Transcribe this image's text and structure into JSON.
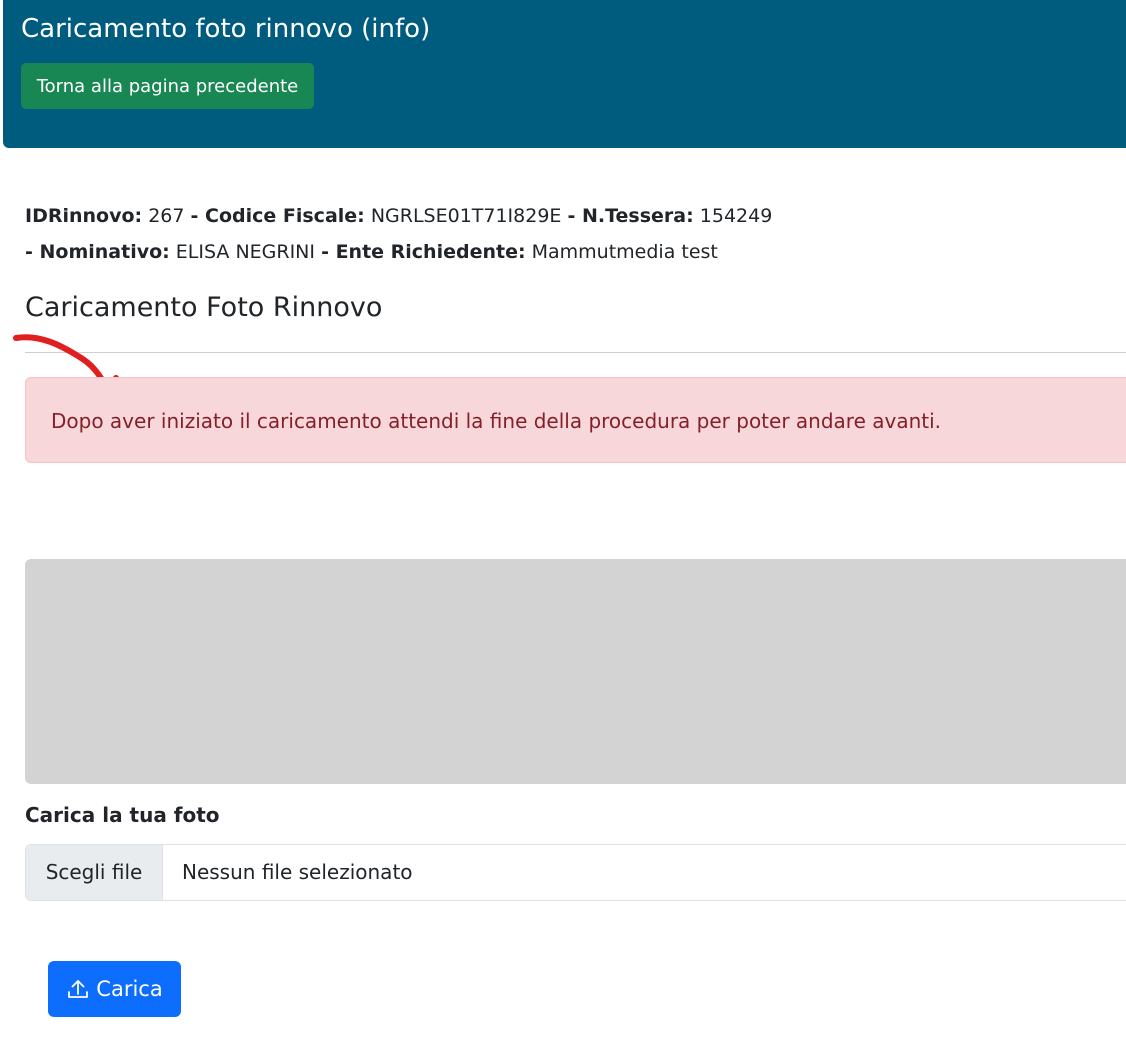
{
  "header": {
    "title": "Caricamento foto rinnovo (info)",
    "back_label": "Torna alla pagina precedente",
    "bg_color": "#005c7e",
    "back_color": "#198754"
  },
  "info": {
    "id_label": "IDRinnovo:",
    "id_value": "267",
    "cf_label": "- Codice Fiscale:",
    "cf_value": "NGRLSE01T71I829E",
    "tessera_label": "- N.Tessera:",
    "tessera_value": "154249",
    "nominativo_label": "- Nominativo:",
    "nominativo_value": "ELISA NEGRINI",
    "ente_label": "- Ente Richiedente:",
    "ente_value": "Mammutmedia test"
  },
  "section": {
    "title": "Caricamento Foto Rinnovo"
  },
  "alert": {
    "message": "Dopo aver iniziato il caricamento attendi la fine della procedura per poter andare avanti.",
    "bg_color": "#f8d7da",
    "text_color": "#842029"
  },
  "upload": {
    "label": "Carica la tua foto",
    "choose_label": "Scegli file",
    "status": "Nessun file selezionato",
    "button_label": "Carica",
    "button_icon": "upload-icon",
    "button_color": "#0d6efd"
  },
  "annotation": {
    "arrow_icon": "red-arrow-icon",
    "color": "#e02020"
  }
}
